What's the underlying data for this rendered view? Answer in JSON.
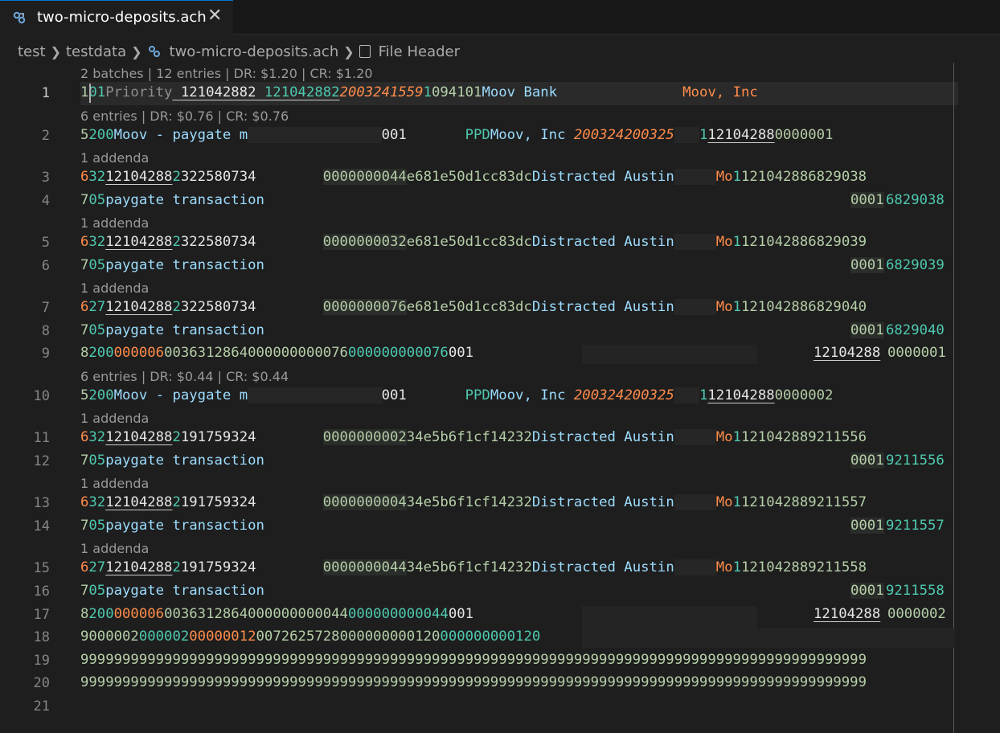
{
  "tab": {
    "title": "two-micro-deposits.ach",
    "close": "✕"
  },
  "breadcrumb": [
    "test",
    "testdata",
    "two-micro-deposits.ach",
    "File Header"
  ],
  "lenses": {
    "file": "2 batches | 12 entries | DR: $1.20 | CR: $1.20",
    "batch1": "6 entries | DR: $0.76 | CR: $0.76",
    "batch2": "6 entries | DR: $0.44 | CR: $0.44",
    "addenda": "1 addenda"
  },
  "lines": {
    "l1": [
      "1",
      "01",
      "Priority",
      " 121042882",
      " 121042882",
      "2003241559",
      "1",
      "094101",
      "Moov Bank               ",
      "Moov, Inc"
    ],
    "l2": [
      "5",
      "200",
      "Moov - paygate m",
      "                ",
      "001",
      "       ",
      "PPD",
      "Moov, Inc ",
      "200324",
      "200325",
      "   ",
      "1",
      "12104288",
      "0000001"
    ],
    "l3": [
      "6",
      "32",
      "12104288",
      "2",
      "322580734",
      "        ",
      "0000000044",
      "e681e50d1cc83dc",
      "Distracted Austin",
      "     ",
      "Mo",
      "1",
      "121042886829038"
    ],
    "l4": [
      "7",
      "05",
      "paygate transaction",
      "0001",
      "6829038"
    ],
    "l5": [
      "6",
      "32",
      "12104288",
      "2",
      "322580734",
      "        ",
      "0000000032",
      "e681e50d1cc83dc",
      "Distracted Austin",
      "     ",
      "Mo",
      "1",
      "121042886829039"
    ],
    "l6": [
      "7",
      "05",
      "paygate transaction",
      "0001",
      "6829039"
    ],
    "l7": [
      "6",
      "27",
      "12104288",
      "2",
      "322580734",
      "        ",
      "0000000076",
      "e681e50d1cc83dc",
      "Distracted Austin",
      "     ",
      "Mo",
      "1",
      "121042886829040"
    ],
    "l8": [
      "7",
      "05",
      "paygate transaction",
      "0001",
      "6829040"
    ],
    "l9": [
      "8",
      "200",
      "000006",
      "0036312864",
      "000000000076",
      "000000000076",
      "001",
      "12104288",
      "0000001"
    ],
    "l10": [
      "5",
      "200",
      "Moov - paygate m",
      "                ",
      "001",
      "       ",
      "PPD",
      "Moov, Inc ",
      "200324",
      "200325",
      "   ",
      "1",
      "12104288",
      "0000002"
    ],
    "l11": [
      "6",
      "32",
      "12104288",
      "2",
      "191759324",
      "        ",
      "0000000002",
      "34e5b6f1cf14232",
      "Distracted Austin",
      "     ",
      "Mo",
      "1",
      "121042889211556"
    ],
    "l12": [
      "7",
      "05",
      "paygate transaction",
      "0001",
      "9211556"
    ],
    "l13": [
      "6",
      "32",
      "12104288",
      "2",
      "191759324",
      "        ",
      "0000000004",
      "34e5b6f1cf14232",
      "Distracted Austin",
      "     ",
      "Mo",
      "1",
      "121042889211557"
    ],
    "l14": [
      "7",
      "05",
      "paygate transaction",
      "0001",
      "9211557"
    ],
    "l15": [
      "6",
      "27",
      "12104288",
      "2",
      "191759324",
      "        ",
      "0000000044",
      "34e5b6f1cf14232",
      "Distracted Austin",
      "     ",
      "Mo",
      "1",
      "121042889211558"
    ],
    "l16": [
      "7",
      "05",
      "paygate transaction",
      "0001",
      "9211558"
    ],
    "l17": [
      "8",
      "200",
      "000006",
      "0036312864",
      "000000000044",
      "000000000044",
      "001",
      "12104288",
      "0000002"
    ],
    "l18": [
      "9",
      "000002",
      "000002",
      "00000012",
      "0072625728",
      "000000000120",
      "000000000120"
    ],
    "l19": "9999999999999999999999999999999999999999999999999999999999999999999999999999999999999999999999",
    "l20": "9999999999999999999999999999999999999999999999999999999999999999999999999999999999999999999999"
  },
  "line_numbers": [
    "1",
    "2",
    "3",
    "4",
    "5",
    "6",
    "7",
    "8",
    "9",
    "10",
    "11",
    "12",
    "13",
    "14",
    "15",
    "16",
    "17",
    "18",
    "19",
    "20",
    "21"
  ]
}
